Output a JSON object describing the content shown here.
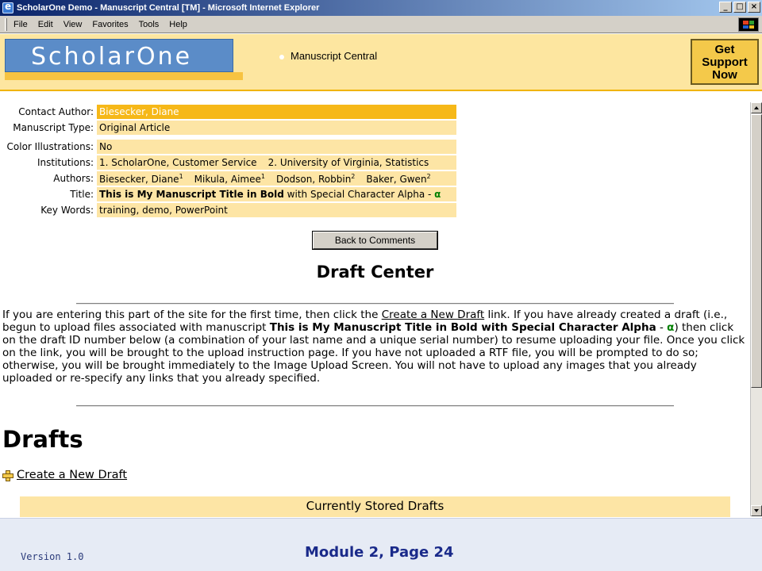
{
  "window": {
    "title": "ScholarOne Demo - Manuscript Central [TM] - Microsoft Internet Explorer",
    "controls": [
      "_",
      "□",
      "×"
    ]
  },
  "menu": {
    "items": [
      "File",
      "Edit",
      "View",
      "Favorites",
      "Tools",
      "Help"
    ]
  },
  "banner": {
    "logo": "ScholarOne",
    "site_name": "Manuscript Central",
    "support_lines": [
      "Get",
      "Support",
      "Now"
    ]
  },
  "manuscript": {
    "rows": [
      {
        "label": "Contact Author:",
        "value": "Biesecker, Diane"
      },
      {
        "label": "Manuscript Type:",
        "value": "Original Article"
      },
      {
        "label": "Color Illustrations:",
        "value": "No"
      },
      {
        "label": "Institutions:",
        "parts": [
          "1. ScholarOne, Customer Service",
          "2. University of Virginia, Statistics"
        ]
      },
      {
        "label": "Authors:",
        "authors": [
          {
            "name": "Biesecker, Diane",
            "sup": "1"
          },
          {
            "name": "Mikula, Aimee",
            "sup": "1"
          },
          {
            "name": "Dodson, Robbin",
            "sup": "2"
          },
          {
            "name": "Baker, Gwen",
            "sup": "2"
          }
        ]
      },
      {
        "label": "Title:",
        "bold": "This is My Manuscript Title in Bold",
        "rest": " with Special Character Alpha - ",
        "alpha": "α"
      },
      {
        "label": "Key Words:",
        "value": "training, demo, PowerPoint"
      }
    ]
  },
  "back_button": "Back to Comments",
  "draft_center": {
    "heading": "Draft Center",
    "p1": "If you are entering this part of the site for the first time, then click the ",
    "link": "Create a New Draft",
    "p2": " link. If you have already created a draft (i.e., begun to upload files associated with manuscript ",
    "ms_title": "This is My Manuscript Title in Bold with Special Character Alpha",
    "p3": " - ",
    "alpha": "α",
    "p4": ") then click on the draft ID number below (a combination of your last name and a unique serial number) to resume uploading your file. Once you click on the link, you will be brought to the upload instruction page. If you have not uploaded a RTF file, you will be prompted to do so; otherwise, you will be brought immediately to the Image Upload Screen. You will not have to upload any images that you already uploaded or re-specify any links that you already specified."
  },
  "drafts": {
    "heading": "Drafts",
    "create_link": "Create a New Draft",
    "stored_title": "Currently Stored Drafts"
  },
  "footer": {
    "version": "Version 1.0",
    "module": "Module 2, Page 24"
  }
}
